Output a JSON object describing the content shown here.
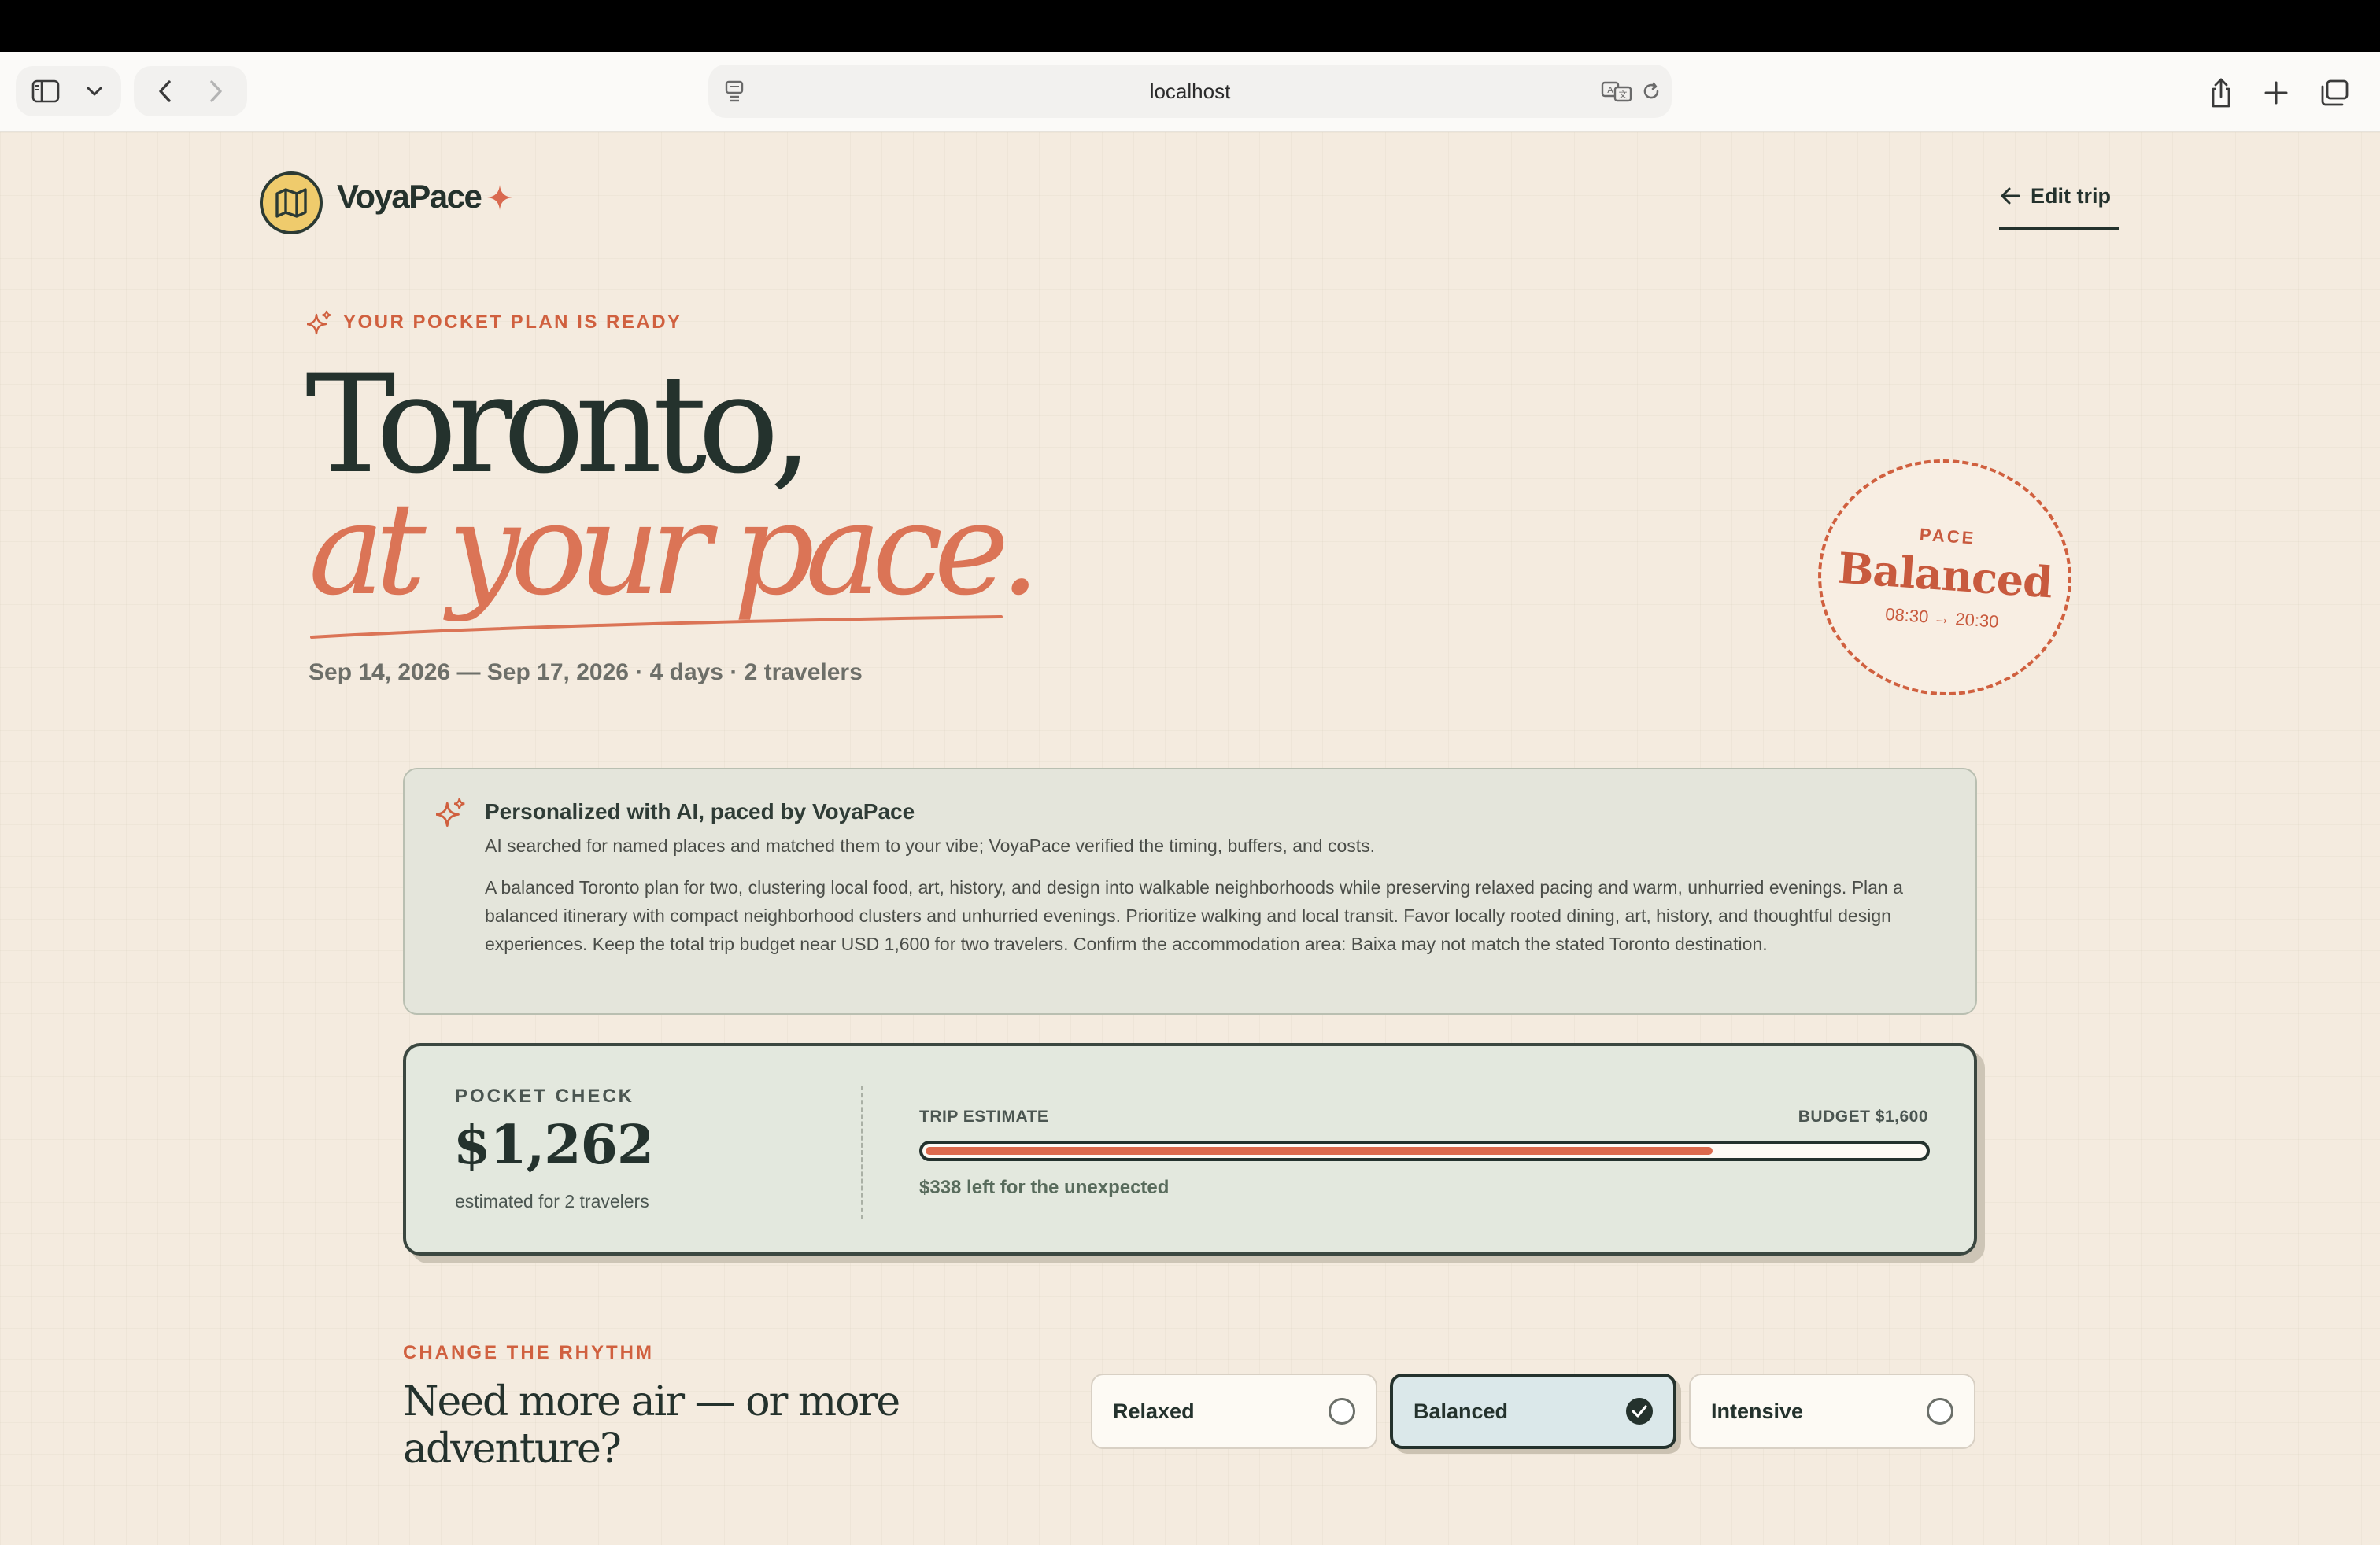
{
  "browser": {
    "address": "localhost"
  },
  "app": {
    "brand": "VoyaPace",
    "edit_trip_label": "Edit trip"
  },
  "hero": {
    "eyebrow": "YOUR POCKET PLAN IS READY",
    "title_line1": "Toronto,",
    "title_line2": "at your pace.",
    "meta": "Sep 14, 2026 — Sep 17, 2026 · 4 days · 2 travelers"
  },
  "pace_stamp": {
    "label": "PACE",
    "value": "Balanced",
    "hours": "08:30 → 20:30"
  },
  "ai_card": {
    "title": "Personalized with AI, paced by VoyaPace",
    "subtitle": "AI searched for named places and matched them to your vibe; VoyaPace verified the timing, buffers, and costs.",
    "body": "A balanced Toronto plan for two, clustering local food, art, history, and design into walkable neighborhoods while preserving relaxed pacing and warm, unhurried evenings. Plan a balanced itinerary with compact neighborhood clusters and unhurried evenings. Prioritize walking and local transit. Favor locally rooted dining, art, history, and thoughtful design experiences. Keep the total trip budget near USD 1,600 for two travelers. Confirm the accommodation area: Baixa may not match the stated Toronto destination."
  },
  "pocket_check": {
    "label": "POCKET CHECK",
    "amount": "$1,262",
    "note": "estimated for 2 travelers",
    "estimate_label": "TRIP ESTIMATE",
    "budget_label": "BUDGET $1,600",
    "spent_fraction": 0.789,
    "left_note": "$338 left for the unexpected"
  },
  "rhythm": {
    "label": "CHANGE THE RHYTHM",
    "question": "Need more air — or more adventure?",
    "options": [
      {
        "label": "Relaxed",
        "selected": false
      },
      {
        "label": "Balanced",
        "selected": true
      },
      {
        "label": "Intensive",
        "selected": false
      }
    ]
  },
  "colors": {
    "background": "#f4ebdf",
    "ink": "#24322d",
    "accent": "#d9694f",
    "logo_yellow": "#efcb6c",
    "card_green": "#e3e8de"
  }
}
